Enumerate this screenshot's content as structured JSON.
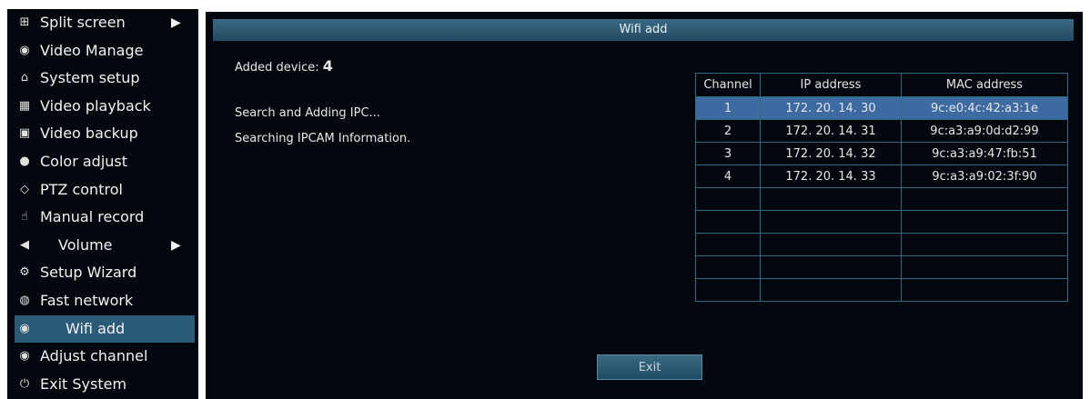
{
  "menu": {
    "items": [
      {
        "icon": "grid-icon",
        "glyph": "⊞",
        "label": "Split screen",
        "arrow": "▶",
        "centered": false
      },
      {
        "icon": "camera-icon",
        "glyph": "◉",
        "label": "Video Manage",
        "centered": false
      },
      {
        "icon": "house-icon",
        "glyph": "⌂",
        "label": "System setup",
        "centered": false
      },
      {
        "icon": "film-icon",
        "glyph": "▦",
        "label": "Video playback",
        "centered": false
      },
      {
        "icon": "floppy-icon",
        "glyph": "▣",
        "label": "Video backup",
        "centered": false
      },
      {
        "icon": "palette-icon",
        "glyph": "●",
        "label": "Color adjust",
        "centered": false
      },
      {
        "icon": "ptz-icon",
        "glyph": "◇",
        "label": "PTZ control",
        "centered": false
      },
      {
        "icon": "hand-icon",
        "glyph": "☝",
        "label": "Manual record",
        "centered": false
      },
      {
        "icon": "speaker-icon",
        "glyph": "◀",
        "label": "Volume",
        "arrow": "▶",
        "centered": true
      },
      {
        "icon": "wizard-icon",
        "glyph": "⚙",
        "label": "Setup Wizard",
        "centered": false
      },
      {
        "icon": "network-icon",
        "glyph": "◍",
        "label": "Fast network",
        "centered": false
      },
      {
        "icon": "camera-icon",
        "glyph": "◉",
        "label": "Wifi add",
        "selected": true,
        "centered": true
      },
      {
        "icon": "camera-icon",
        "glyph": "◉",
        "label": "Adjust channel",
        "centered": false
      },
      {
        "icon": "power-icon",
        "glyph": "⏻",
        "label": "Exit System",
        "centered": false
      }
    ]
  },
  "dialog": {
    "title": "Wifi add",
    "added_device_label": "Added device:",
    "added_device_count": "4",
    "status_line1": "Search and Adding IPC...",
    "status_line2": "Searching IPCAM Information.",
    "exit_label": "Exit"
  },
  "table": {
    "headers": [
      "Channel",
      "IP address",
      "MAC address"
    ],
    "rows": [
      [
        "1",
        "172. 20. 14. 30",
        "9c:e0:4c:42:a3:1e"
      ],
      [
        "2",
        "172. 20. 14. 31",
        "9c:a3:a9:0d:d2:99"
      ],
      [
        "3",
        "172. 20. 14. 32",
        "9c:a3:a9:47:fb:51"
      ],
      [
        "4",
        "172. 20. 14. 33",
        "9c:a3:a9:02:3f:90"
      ],
      [
        "",
        "",
        ""
      ],
      [
        "",
        "",
        ""
      ],
      [
        "",
        "",
        ""
      ],
      [
        "",
        "",
        ""
      ],
      [
        "",
        "",
        ""
      ]
    ],
    "selected_row": 0
  }
}
